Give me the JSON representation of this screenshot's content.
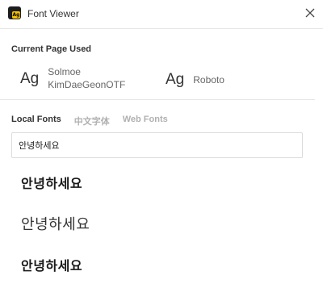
{
  "header": {
    "app_icon_glyph": "Ag",
    "title": "Font Viewer",
    "close_icon": "close-icon"
  },
  "current_page": {
    "label": "Current Page Used",
    "fonts": [
      {
        "sample": "Ag",
        "name_line1": "Solmoe",
        "name_line2": "KimDaeGeonOTF"
      },
      {
        "sample": "Ag",
        "name_line1": "Roboto",
        "name_line2": ""
      }
    ]
  },
  "tabs": [
    {
      "label": "Local Fonts",
      "active": true
    },
    {
      "label": "中文字体",
      "active": false
    },
    {
      "label": "Web Fonts",
      "active": false
    }
  ],
  "search": {
    "value": "안녕하세요"
  },
  "previews": [
    {
      "text": "안녕하세요"
    },
    {
      "text": "안녕하세요"
    },
    {
      "text": "안녕하세요"
    }
  ],
  "colors": {
    "app_icon_bg": "#1d1d1d",
    "app_icon_accent": "#f5c400"
  }
}
